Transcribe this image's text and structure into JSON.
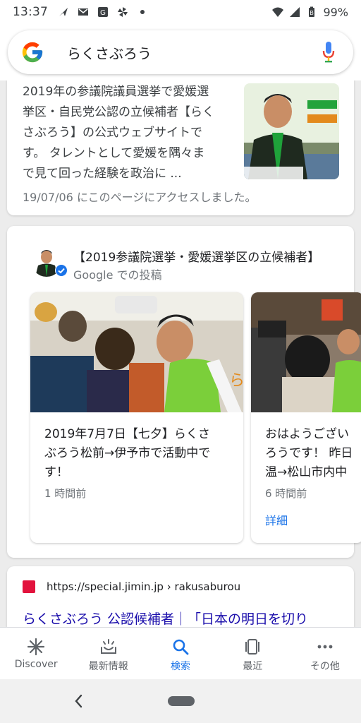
{
  "status_bar": {
    "time": "13:37",
    "left_icons": [
      "send-icon",
      "gmail-icon",
      "google-news-icon",
      "pinwheel-icon",
      "dot-icon"
    ],
    "battery": "99%"
  },
  "search": {
    "query": "らくさぶろう"
  },
  "results": {
    "snippet_card": {
      "snippet_lines": [
        "2019年の参議院議員選挙で愛媛選",
        "挙区・自民党公認の立候補者【らく",
        "さぶろう】の公式ウェブサイトで",
        "す。 タレントとして愛媛を隅々ま",
        "で見て回った経験を政治に ..."
      ],
      "visited_note": "19/07/06 にこのページにアクセスしました。"
    },
    "posts_card": {
      "title": "【2019参議院選挙・愛媛選挙区の立候補者】",
      "subtitle": "Google での投稿",
      "posts": [
        {
          "lines": [
            "2019年7月7日【七夕】らくさ",
            "ぶろう松前→伊予市で活動中で",
            "す！"
          ],
          "time": "1 時間前",
          "more": ""
        },
        {
          "lines": [
            "おはようござい",
            "ろうです！ 昨日",
            "温→松山市内中"
          ],
          "time": "6 時間前",
          "more": "詳細"
        }
      ]
    },
    "link_card": {
      "url": "https://special.jimin.jp › rakusaburou",
      "title": "らくさぶろう 公認候補者｜「日本の明日を切り"
    }
  },
  "bottom_nav": {
    "items": [
      {
        "label": "Discover",
        "icon": "asterisk-icon",
        "active": false
      },
      {
        "label": "最新情報",
        "icon": "updates-icon",
        "active": false
      },
      {
        "label": "検索",
        "icon": "search-icon",
        "active": true
      },
      {
        "label": "最近",
        "icon": "recent-icon",
        "active": false
      },
      {
        "label": "その他",
        "icon": "more-icon",
        "active": false
      }
    ]
  },
  "colors": {
    "accent_blue": "#1a73e8",
    "link_blue": "#1a0dab",
    "favicon_red": "#e2133d"
  }
}
